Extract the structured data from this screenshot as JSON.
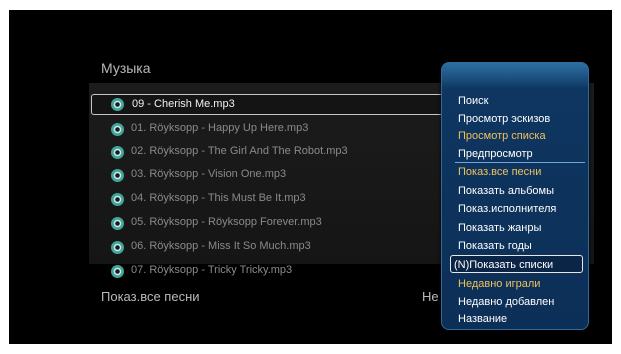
{
  "screen": {
    "title": "Музыка",
    "bottom_label": "Показ.все песни",
    "bottom_right": "Не"
  },
  "tracks": [
    {
      "label": "09 - Cherish Me.mp3",
      "icon": "music-disc-icon"
    },
    {
      "label": "01. Röyksopp - Happy Up Here.mp3",
      "icon": "music-disc-icon"
    },
    {
      "label": "02. Röyksopp - The Girl And The Robot.mp3",
      "icon": "music-disc-icon"
    },
    {
      "label": "03. Röyksopp - Vision One.mp3",
      "icon": "music-disc-icon"
    },
    {
      "label": "04. Röyksopp - This Must Be It.mp3",
      "icon": "music-disc-icon"
    },
    {
      "label": "05. Röyksopp - Röyksopp Forever.mp3",
      "icon": "music-disc-icon"
    },
    {
      "label": "06. Röyksopp - Miss It So Much.mp3",
      "icon": "music-disc-icon"
    },
    {
      "label": "07. Röyksopp - Tricky Tricky.mp3",
      "icon": "music-disc-icon"
    }
  ],
  "selected_track": 0,
  "menu": {
    "items": [
      {
        "label": "Поиск"
      },
      {
        "label": "Просмотр эскизов"
      },
      {
        "label": "Просмотр списка"
      },
      {
        "label": "Предпросмотр"
      },
      {
        "label": "Показ.все песни"
      },
      {
        "label": "Показать альбомы"
      },
      {
        "label": "Показ.исполнителя"
      },
      {
        "label": "Показать жанры"
      },
      {
        "label": "Показать годы"
      },
      {
        "label": "(N)Показать списки"
      },
      {
        "label": "Недавно играли"
      },
      {
        "label": "Недавно добавлен"
      },
      {
        "label": "Название"
      }
    ],
    "selected_index": 9
  },
  "colors": {
    "background": "#000000",
    "menu_blue": "#0c2f57",
    "menu_highlight": "#f0c15a",
    "text": "#b9b9b9"
  }
}
